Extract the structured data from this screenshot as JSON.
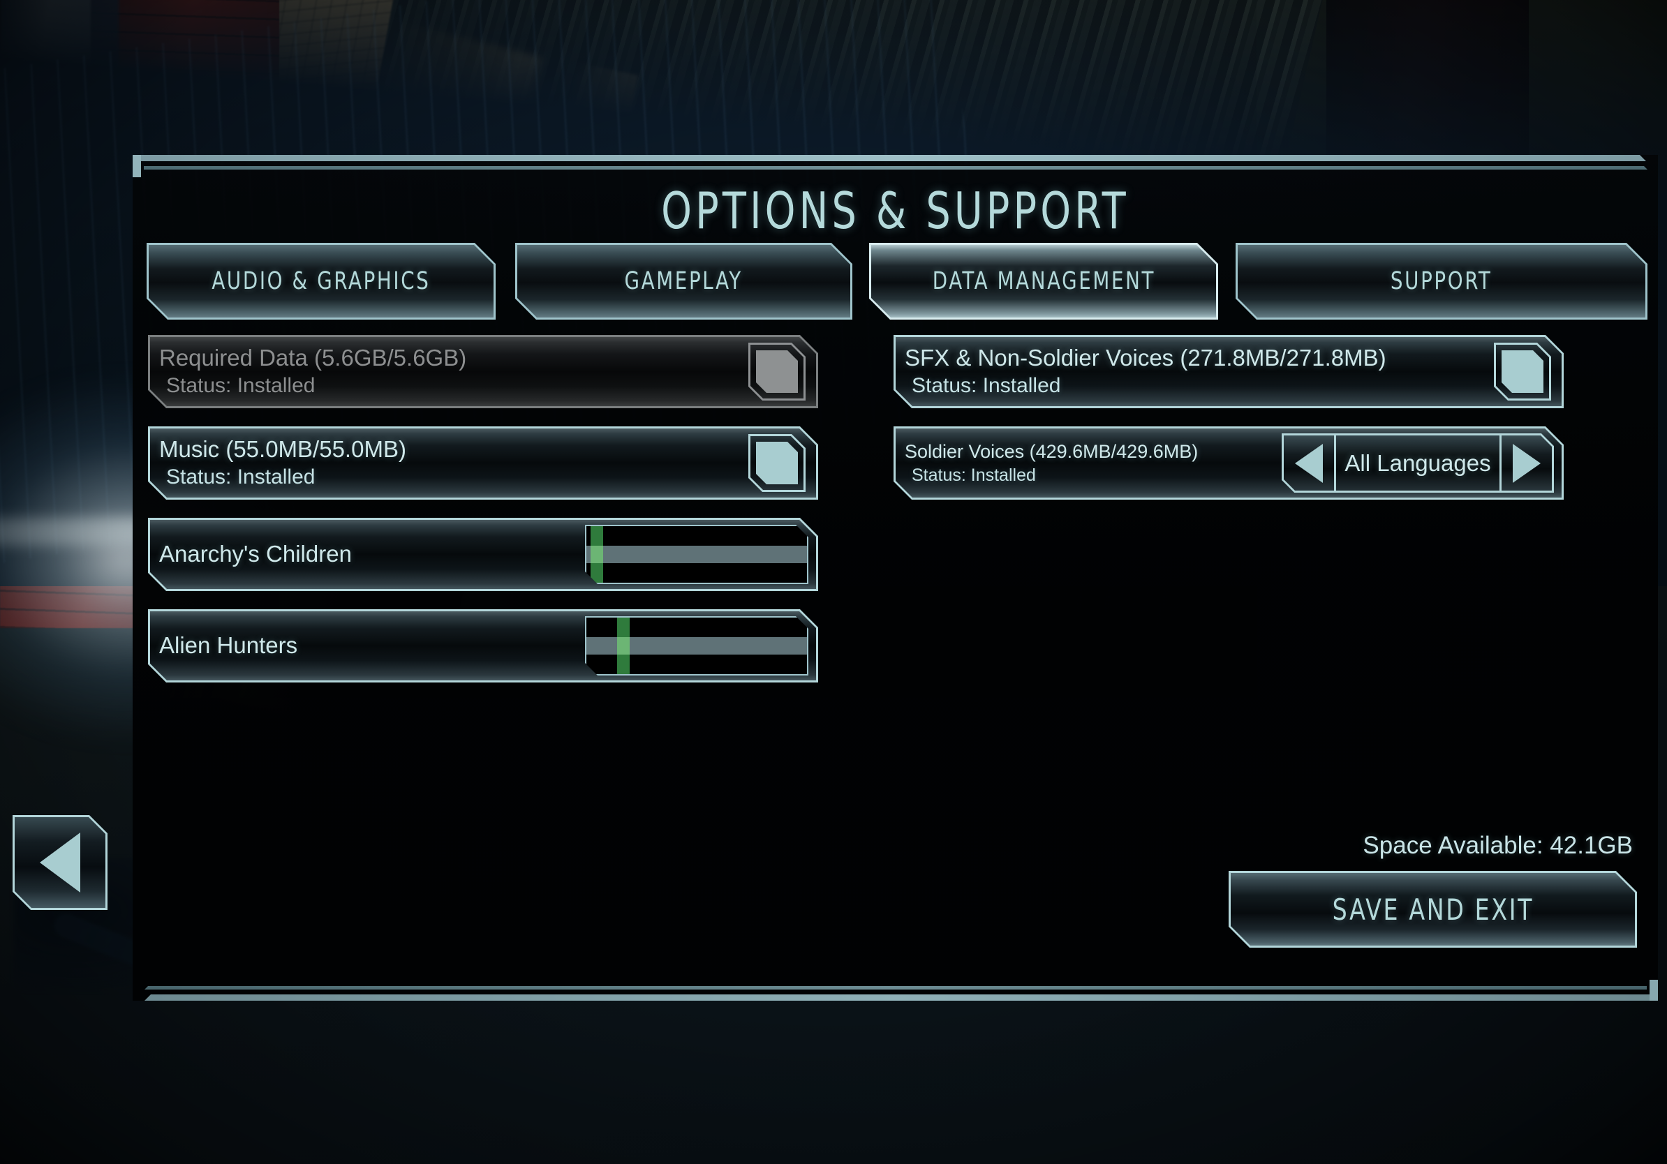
{
  "screen": {
    "title": "OPTIONS & SUPPORT"
  },
  "tabs": [
    {
      "label": "AUDIO & GRAPHICS",
      "active": false
    },
    {
      "label": "GAMEPLAY",
      "active": false
    },
    {
      "label": "DATA MANAGEMENT",
      "active": true
    },
    {
      "label": "SUPPORT",
      "active": false
    }
  ],
  "left_column": [
    {
      "name": "Required Data (5.6GB/5.6GB)",
      "status": "Status: Installed",
      "control": "checkbox",
      "checked": true,
      "disabled": true
    },
    {
      "name": "Music (55.0MB/55.0MB)",
      "status": "Status: Installed",
      "control": "checkbox",
      "checked": true,
      "disabled": false
    },
    {
      "name": "Anarchy's Children",
      "status": "",
      "control": "progress",
      "marker_percent": 2,
      "disabled": false
    },
    {
      "name": "Alien Hunters",
      "status": "",
      "control": "progress",
      "marker_percent": 14,
      "disabled": false
    }
  ],
  "right_column": [
    {
      "name": "SFX & Non-Soldier Voices (271.8MB/271.8MB)",
      "status": "Status: Installed",
      "control": "checkbox",
      "checked": true,
      "disabled": false
    },
    {
      "name": "Soldier Voices (429.6MB/429.6MB)",
      "status": "Status: Installed",
      "control": "stepper",
      "value": "All Languages",
      "prev_icon": "triangle-left-icon",
      "next_icon": "triangle-right-icon",
      "disabled": false
    }
  ],
  "footer": {
    "space_available": "Space Available: 42.1GB",
    "save_label": "SAVE AND EXIT"
  },
  "back_button": {
    "icon": "triangle-left-icon"
  },
  "colors": {
    "accent": "#b4d9da",
    "panel_border": "#9fc4cb",
    "disabled": "#8d8f90",
    "progress_marker": "#2f7b3c",
    "progress_marker_light": "#6cb574",
    "progress_band": "#5f7277"
  }
}
